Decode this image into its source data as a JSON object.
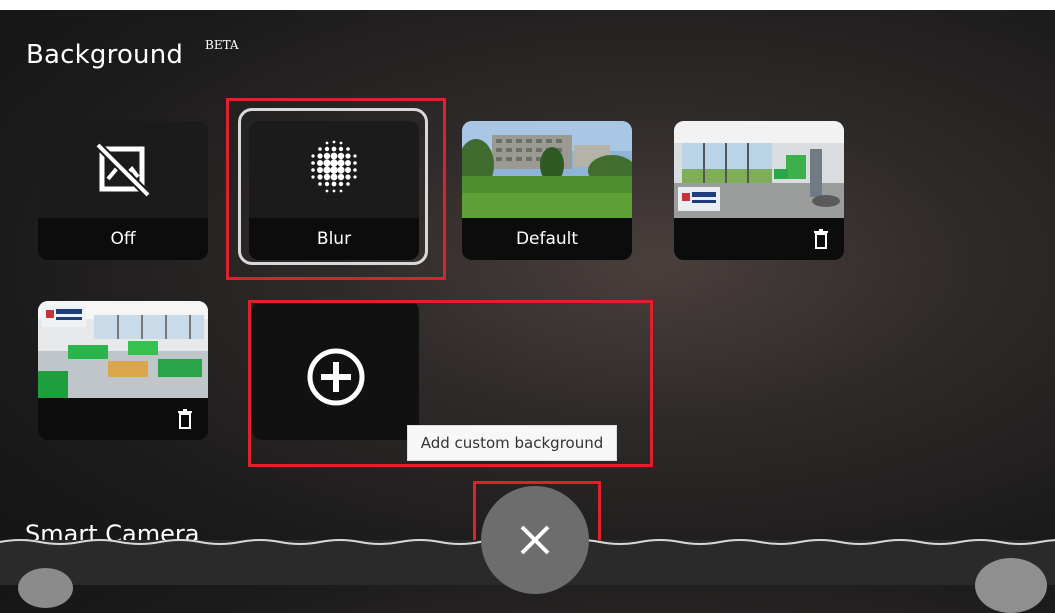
{
  "panel": {
    "title": "Background",
    "badge": "BETA",
    "section2_title": "Smart Camera"
  },
  "tiles": {
    "off": {
      "label": "Off",
      "icon": "no-image-icon"
    },
    "blur": {
      "label": "Blur",
      "icon": "blur-dots-icon",
      "selected": true
    },
    "default": {
      "label": "Default"
    },
    "custom1": {
      "icon": "trash-icon"
    },
    "custom2": {
      "icon": "trash-icon"
    },
    "add": {
      "icon": "add-circle-icon",
      "tooltip": "Add custom background"
    }
  },
  "controls": {
    "close_icon": "close-icon"
  },
  "colors": {
    "highlight": "#e0202a",
    "selected_ring": "#d8d8d8",
    "close_button": "#6d6d6d"
  }
}
